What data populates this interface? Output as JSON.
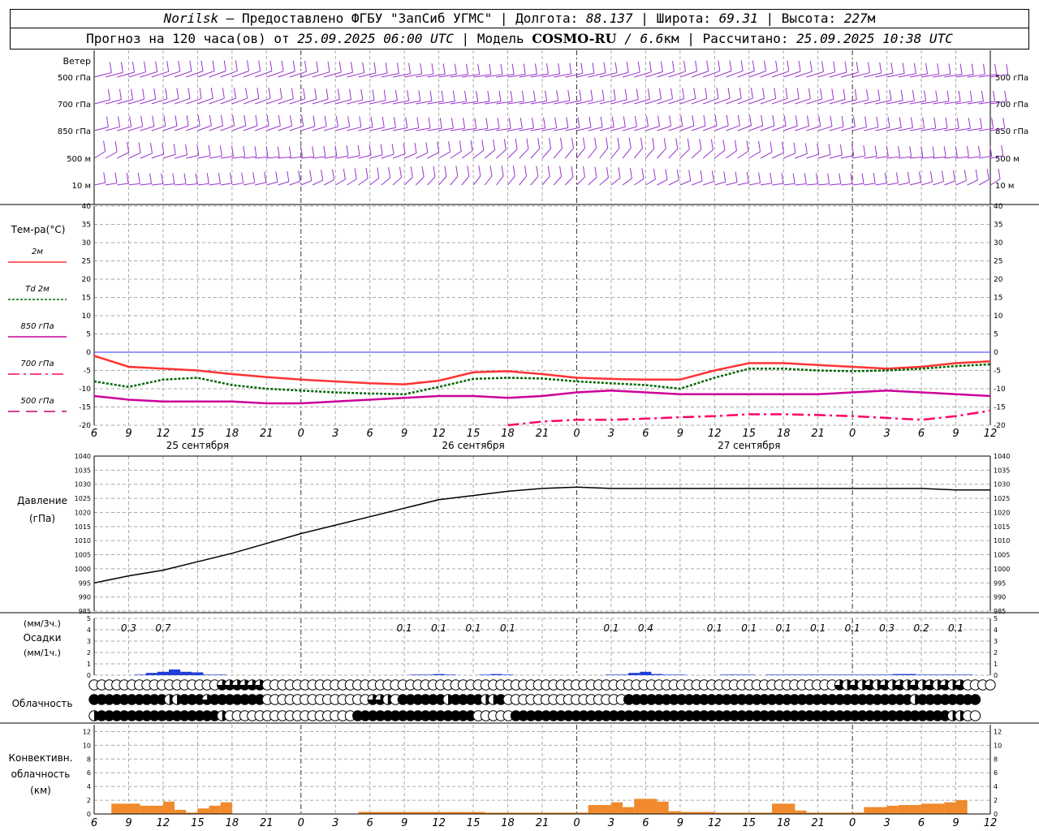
{
  "header": {
    "station": "Norilsk",
    "dash": " – ",
    "provider": "Предоставлено ФГБУ \"ЗапСиб УГМС\"",
    "sep": " | ",
    "lon_label": "Долгота: ",
    "lon": "88.137",
    "lat_label": "Широта: ",
    "lat": "69.31",
    "alt_label": "Высота: ",
    "alt": "227",
    "alt_unit": "м",
    "forecast_prefix": "Прогноз на 120 часа(ов) от ",
    "forecast_time": "25.09.2025 06:00 UTC",
    "model_label": "Модель ",
    "model": "COSMO-RU",
    "model_res": " / 6.6",
    "model_res_unit": "км",
    "calc_label": "Рассчитано: ",
    "calc_time": "25.09.2025 10:38 UTC"
  },
  "wind_panel": {
    "title": "Ветер",
    "levels": [
      "500 гПа",
      "700 гПа",
      "850 гПа",
      "500 м",
      "10  м"
    ],
    "color": "#9932cc"
  },
  "time_axis": {
    "ticks": [
      "6",
      "9",
      "12",
      "15",
      "18",
      "21",
      "0",
      "3",
      "6",
      "9",
      "12",
      "15",
      "18",
      "21",
      "0",
      "3",
      "6",
      "9",
      "12",
      "15",
      "18",
      "21",
      "0",
      "3",
      "6",
      "9",
      "12"
    ],
    "day_labels": [
      "25 сентября",
      "26 сентября",
      "27 сентября"
    ]
  },
  "temp_legend": {
    "title": "Тем-ра(°С)",
    "items": [
      {
        "label": "2м",
        "color": "#ff3333",
        "style": "solid"
      },
      {
        "label": "Td  2м",
        "color": "#006600",
        "style": "dotted"
      },
      {
        "label": "850 гПа",
        "color": "#cc0099",
        "style": "solid"
      },
      {
        "label": "700 гПа",
        "color": "#ff0066",
        "style": "dashdot"
      },
      {
        "label": "500 гПа",
        "color": "#cc0066",
        "style": "dashed"
      }
    ]
  },
  "pressure_labels": {
    "title": "Давление",
    "unit": "(гПа)"
  },
  "precip_labels": {
    "unit3": "(мм/3ч.)",
    "title": "Осадки",
    "unit1": "(мм/1ч.)"
  },
  "cloud_label": "Облачность",
  "conv_labels": {
    "line1": "Конвективн.",
    "line2": "облачность",
    "line3": "(км)"
  },
  "chart_data": [
    {
      "type": "line",
      "title": "Тем-ра(°С)",
      "x": [
        0,
        3,
        6,
        9,
        12,
        15,
        18,
        21,
        24,
        27,
        30,
        33,
        36,
        39,
        42,
        45,
        48,
        51,
        54,
        57,
        60,
        63,
        66,
        69,
        72,
        75,
        78
      ],
      "ylim": [
        -20,
        40
      ],
      "yticks": [
        -20,
        -15,
        -10,
        -5,
        0,
        5,
        10,
        15,
        20,
        25,
        30,
        35,
        40
      ],
      "series": [
        {
          "name": "2м",
          "values": [
            -1,
            -4,
            -4.5,
            -5,
            -6,
            -6.8,
            -7.5,
            -8,
            -8.5,
            -8.8,
            -7.8,
            -5.5,
            -5.2,
            -6,
            -7,
            -7.3,
            -7.5,
            -7.5,
            -5,
            -3,
            -3,
            -3.5,
            -4,
            -4.5,
            -4,
            -3,
            -2.5
          ]
        },
        {
          "name": "Td  2м",
          "values": [
            -8,
            -9.5,
            -7.5,
            -7,
            -9,
            -10,
            -10.5,
            -11,
            -11.3,
            -11.5,
            -9.5,
            -7.3,
            -7,
            -7.2,
            -8,
            -8.5,
            -9,
            -10,
            -7,
            -4.5,
            -4.5,
            -5,
            -5.2,
            -5,
            -4.5,
            -3.8,
            -3.3
          ]
        },
        {
          "name": "850 гПа",
          "values": [
            -12,
            -13,
            -13.5,
            -13.5,
            -13.5,
            -14,
            -14,
            -13.5,
            -13,
            -12.5,
            -12,
            -12,
            -12.5,
            -12,
            -11,
            -10.5,
            -11,
            -11.5,
            -11.5,
            -11.5,
            -11.5,
            -11.5,
            -11,
            -10.5,
            -11,
            -11.5,
            -12
          ]
        },
        {
          "name": "700 гПа",
          "values": [
            null,
            null,
            null,
            null,
            null,
            null,
            null,
            null,
            null,
            null,
            null,
            null,
            -20,
            -19,
            -18.5,
            -18.5,
            -18.2,
            -17.8,
            -17.5,
            -17,
            -17,
            -17.2,
            -17.5,
            -18,
            -18.5,
            -17.5,
            -16
          ]
        },
        {
          "name": "500 гПа",
          "values": []
        }
      ]
    },
    {
      "type": "line",
      "title": "Давление",
      "ylabel": "(гПа)",
      "ylim": [
        985,
        1040
      ],
      "yticks": [
        985,
        990,
        995,
        1000,
        1005,
        1010,
        1015,
        1020,
        1025,
        1030,
        1035,
        1040
      ],
      "x": [
        0,
        3,
        6,
        9,
        12,
        15,
        18,
        21,
        24,
        27,
        30,
        33,
        36,
        39,
        42,
        45,
        48,
        51,
        54,
        57,
        60,
        63,
        66,
        69,
        72,
        75,
        78
      ],
      "series": [
        {
          "name": "Давление",
          "values": [
            995,
            997.5,
            999.5,
            1002.5,
            1005.5,
            1009,
            1012.5,
            1015.5,
            1018.5,
            1021.5,
            1024.5,
            1026,
            1027.5,
            1028.5,
            1029,
            1028.5,
            1028.5,
            1028.5,
            1028.5,
            1028.5,
            1028.5,
            1028.5,
            1028.5,
            1028.5,
            1028.5,
            1028,
            1028
          ]
        }
      ]
    },
    {
      "type": "bar",
      "title": "Осадки",
      "ylim": [
        0,
        5
      ],
      "yticks": [
        0,
        1,
        2,
        3,
        4,
        5
      ],
      "labels_3h": [
        {
          "x": 3,
          "text": "0.3"
        },
        {
          "x": 6,
          "text": "0.7"
        },
        {
          "x": 27,
          "text": "0.1"
        },
        {
          "x": 30,
          "text": "0.1"
        },
        {
          "x": 33,
          "text": "0.1"
        },
        {
          "x": 36,
          "text": "0.1"
        },
        {
          "x": 45,
          "text": "0.1"
        },
        {
          "x": 48,
          "text": "0.4"
        },
        {
          "x": 54,
          "text": "0.1"
        },
        {
          "x": 57,
          "text": "0.1"
        },
        {
          "x": 60,
          "text": "0.1"
        },
        {
          "x": 63,
          "text": "0.1"
        },
        {
          "x": 66,
          "text": "0.1"
        },
        {
          "x": 69,
          "text": "0.3"
        },
        {
          "x": 72,
          "text": "0.2"
        },
        {
          "x": 75,
          "text": "0.1"
        }
      ],
      "hourly_x": [
        4,
        5,
        6,
        7,
        8,
        9,
        10,
        11,
        28,
        29,
        30,
        31,
        34,
        35,
        36,
        45,
        46,
        47,
        48,
        49,
        50,
        51,
        55,
        56,
        57,
        59,
        60,
        61,
        62,
        63,
        64,
        65,
        66,
        67,
        68,
        69,
        70,
        71,
        72,
        73,
        74,
        75,
        76
      ],
      "hourly": [
        0.05,
        0.2,
        0.3,
        0.5,
        0.3,
        0.25,
        0.05,
        0.05,
        0.05,
        0.05,
        0.1,
        0.05,
        0.05,
        0.1,
        0.05,
        0.05,
        0.05,
        0.2,
        0.3,
        0.1,
        0.05,
        0.05,
        0.05,
        0.05,
        0.05,
        0.05,
        0.05,
        0.05,
        0.05,
        0.05,
        0.05,
        0.05,
        0.05,
        0.05,
        0.05,
        0.05,
        0.1,
        0.1,
        0.05,
        0.05,
        0.05,
        0.05,
        0.05
      ]
    },
    {
      "type": "bar",
      "title": "Конвективн. облачность (км)",
      "ylim": [
        0,
        13
      ],
      "yticks": [
        0,
        2,
        4,
        6,
        8,
        10,
        12
      ],
      "segments": [
        {
          "x0": 1.5,
          "x1": 4,
          "value": 1.5
        },
        {
          "x0": 4,
          "x1": 6,
          "value": 1.2
        },
        {
          "x0": 6,
          "x1": 7,
          "value": 1.8
        },
        {
          "x0": 7,
          "x1": 8,
          "value": 0.6
        },
        {
          "x0": 8,
          "x1": 9,
          "value": 0.2
        },
        {
          "x0": 9,
          "x1": 10,
          "value": 0.8
        },
        {
          "x0": 10,
          "x1": 11,
          "value": 1.2
        },
        {
          "x0": 11,
          "x1": 12,
          "value": 1.7
        },
        {
          "x0": 23,
          "x1": 34,
          "value": 0.3
        },
        {
          "x0": 34,
          "x1": 43,
          "value": 0.2
        },
        {
          "x0": 43,
          "x1": 45,
          "value": 1.3
        },
        {
          "x0": 45,
          "x1": 46,
          "value": 1.7
        },
        {
          "x0": 46,
          "x1": 47,
          "value": 1.0
        },
        {
          "x0": 47,
          "x1": 49,
          "value": 2.2
        },
        {
          "x0": 49,
          "x1": 50,
          "value": 1.8
        },
        {
          "x0": 50,
          "x1": 51,
          "value": 0.4
        },
        {
          "x0": 51,
          "x1": 54,
          "value": 0.3
        },
        {
          "x0": 54,
          "x1": 57,
          "value": 0.2
        },
        {
          "x0": 57,
          "x1": 59,
          "value": 0.2
        },
        {
          "x0": 59,
          "x1": 61,
          "value": 1.5
        },
        {
          "x0": 61,
          "x1": 62,
          "value": 0.5
        },
        {
          "x0": 62,
          "x1": 64,
          "value": 0.2
        },
        {
          "x0": 64,
          "x1": 67,
          "value": 0.2
        },
        {
          "x0": 67,
          "x1": 69,
          "value": 1.0
        },
        {
          "x0": 69,
          "x1": 70,
          "value": 1.2
        },
        {
          "x0": 70,
          "x1": 72,
          "value": 1.3
        },
        {
          "x0": 72,
          "x1": 74,
          "value": 1.5
        },
        {
          "x0": 74,
          "x1": 75,
          "value": 1.7
        },
        {
          "x0": 75,
          "x1": 76,
          "value": 2.0
        }
      ]
    },
    {
      "type": "table",
      "title": "Облачность",
      "rows": [
        "oooooooooooooooooddddddoooooooooooooooooooooooooooooooooooooooooooooooooooooooooooooooooooooooooooodhdhdhdhdhdhdhdhdoooo",
        "ffffffffffhhfffdfffffffooooooooooooooddhoffffffhffffhhfooooooooooooooooffffffffffffffffffffffffffffffffffffffhffffffff",
        "hffffffffffffffffhoooooooooooooooooffffffffffffffffoooooffffffffffffffffffffffffffffffffffffffffffffffffffffffffffhhoo"
      ],
      "legend": {
        "o": "clear",
        "h": "half",
        "d": "mostly",
        "f": "overcast"
      }
    }
  ]
}
